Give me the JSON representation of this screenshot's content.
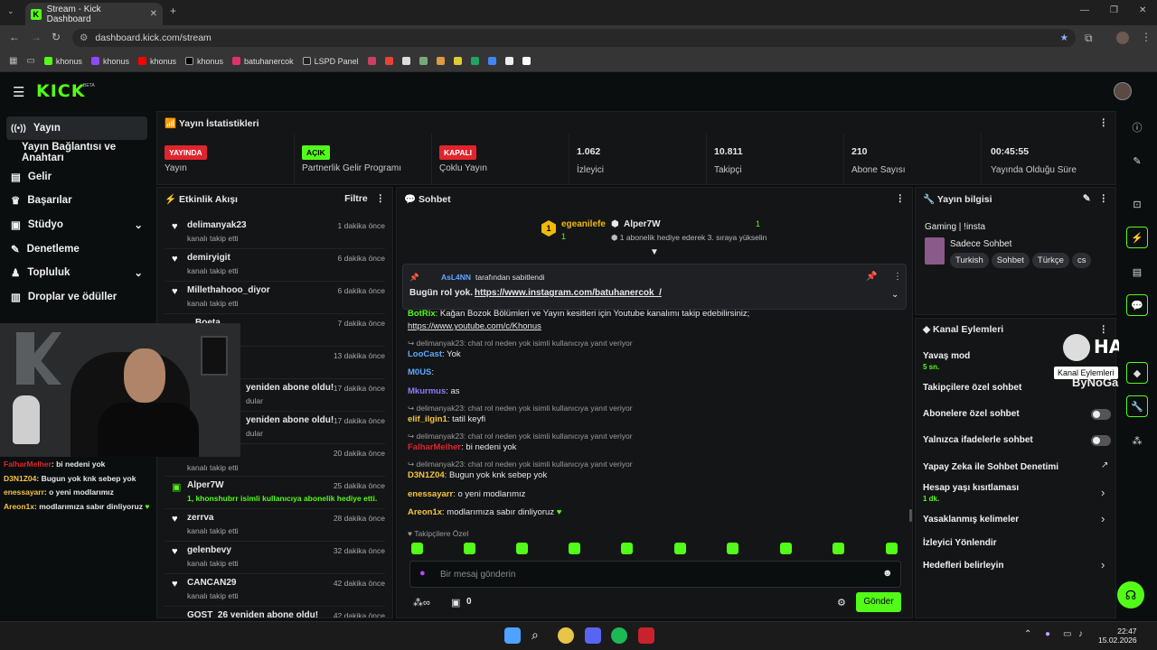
{
  "browser": {
    "tab_title": "Stream - Kick Dashboard",
    "url": "dashboard.kick.com/stream",
    "bookmarks": [
      "khonus",
      "khonus",
      "khonus",
      "khonus",
      "batuhanercok",
      "LSPD Panel"
    ]
  },
  "brand": {
    "logo": "KICK",
    "beta": "BETA",
    "accent": "#53fc18"
  },
  "sidebar": {
    "items": [
      {
        "label": "Yayın",
        "icon": "broadcast-icon"
      },
      {
        "label": "Yayın Bağlantısı ve Anahtarı",
        "icon": ""
      },
      {
        "label": "Gelir",
        "icon": "money-icon"
      },
      {
        "label": "Başarılar",
        "icon": "trophy-icon"
      },
      {
        "label": "Stüdyo",
        "icon": "studio-icon"
      },
      {
        "label": "Denetleme",
        "icon": "wrench-icon"
      },
      {
        "label": "Topluluk",
        "icon": "people-icon"
      },
      {
        "label": "Droplar ve ödüller",
        "icon": "gift-icon"
      }
    ]
  },
  "stats": {
    "title": "Yayın İstatistikleri",
    "items": [
      {
        "badge": "YAYINDA",
        "badge_color": "#e0242e",
        "label": "Yayın"
      },
      {
        "badge": "AÇIK",
        "badge_color": "#53fc18",
        "label": "Partnerlik Gelir Programı"
      },
      {
        "badge": "KAPALI",
        "badge_color": "#e0242e",
        "label": "Çoklu Yayın"
      },
      {
        "value": "1.062",
        "label": "İzleyici"
      },
      {
        "value": "10.811",
        "label": "Takipçi"
      },
      {
        "value": "210",
        "label": "Abone Sayısı"
      },
      {
        "value": "00:45:55",
        "label": "Yayında Olduğu Süre"
      }
    ]
  },
  "activity": {
    "title": "Etkinlik Akışı",
    "filter": "Filtre",
    "events": [
      {
        "name": "delimanyak23",
        "desc": "kanalı takip etti",
        "time": "1 dakika önce"
      },
      {
        "name": "demiryigit",
        "desc": "kanalı takip etti",
        "time": "6 dakika önce"
      },
      {
        "name": "Millethahooo_diyor",
        "desc": "kanalı takip etti",
        "time": "6 dakika önce"
      },
      {
        "name": "Boeta",
        "desc": "",
        "time": "7 dakika önce"
      },
      {
        "name": "",
        "desc": "",
        "time": "13 dakika önce"
      },
      {
        "name": "yeniden abone oldu!",
        "desc": "dular",
        "time": "17 dakika önce"
      },
      {
        "name": "yeniden abone oldu!",
        "desc": "dular",
        "time": "17 dakika önce"
      },
      {
        "name": "",
        "desc": "",
        "time": "20 dakika önce"
      },
      {
        "name": "",
        "desc": "kanalı takip etti",
        "time": ""
      },
      {
        "name": "Alper7W",
        "desc": "1, khonshubrr isimli kullanıcıya abonelik hediye etti.",
        "time": "25 dakika önce"
      },
      {
        "name": "zerrva",
        "desc": "kanalı takip etti",
        "time": "28 dakika önce"
      },
      {
        "name": "gelenbevy",
        "desc": "kanalı takip etti",
        "time": "32 dakika önce"
      },
      {
        "name": "CANCAN29",
        "desc": "kanalı takip etti",
        "time": "42 dakika önce"
      },
      {
        "name": "GOST_26 yeniden abone oldu!",
        "desc": "",
        "time": "42 dakika önce"
      }
    ]
  },
  "overlay_chat": [
    {
      "user": "FalharMelher",
      "text": ": bi nedeni yok",
      "color": "#e0242e"
    },
    {
      "user": "D3N1Z04",
      "text": ": Bugun yok knk sebep yok",
      "color": "#f5c542"
    },
    {
      "user": "enessayarr",
      "text": ": o yeni modlarımız",
      "color": "#f5c542"
    },
    {
      "user": "Areon1x",
      "text": ": modlarımıza sabır dinliyoruz",
      "color": "#f5c542"
    }
  ],
  "chat": {
    "title": "Sohbet",
    "top": [
      {
        "name": "egeanilefe",
        "count": "1"
      },
      {
        "name": "Alper7W",
        "count": "1",
        "note": "1 abonelik hediye ederek 3. sıraya yükselin"
      }
    ],
    "pinned": {
      "user": "AsL4NN",
      "by": "tarafından sabitlendi",
      "text": "Bugün rol yok.",
      "link": "https://www.instagram.com/batuhanercok_/"
    },
    "messages": [
      {
        "type": "msg",
        "user": "BotRix",
        "color": "#53fc18",
        "text": ": Kağan Bozok Bölümleri ve Yayın kesitleri için Youtube kanalımı takip edebilirsiniz;"
      },
      {
        "type": "link",
        "text": "https://www.youtube.com/c/Khonus"
      },
      {
        "type": "reply",
        "text": "delimanyak23: chat rol neden yok isimli kullanıcıya yanıt veriyor"
      },
      {
        "type": "msg",
        "user": "LooCast",
        "color": "#5fa8ff",
        "text": ": Yok"
      },
      {
        "type": "msg",
        "user": "M0US",
        "color": "#5fa8ff",
        "text": ":"
      },
      {
        "type": "msg",
        "user": "Mkurmus",
        "color": "#8a7dff",
        "text": ": as"
      },
      {
        "type": "reply",
        "text": "delimanyak23: chat rol neden yok isimli kullanıcıya yanıt veriyor"
      },
      {
        "type": "msg",
        "user": "elif_ilgin1",
        "color": "#f5c542",
        "text": ": tatil keyfi"
      },
      {
        "type": "reply",
        "text": "delimanyak23: chat rol neden yok isimli kullanıcıya yanıt veriyor"
      },
      {
        "type": "msg",
        "user": "FalharMelher",
        "color": "#e0242e",
        "text": ": bi nedeni yok"
      },
      {
        "type": "reply",
        "text": "delimanyak23: chat rol neden yok isimli kullanıcıya yanıt veriyor"
      },
      {
        "type": "msg",
        "user": "D3N1Z04",
        "color": "#f5c542",
        "text": ": Bugun yok knk sebep yok"
      },
      {
        "type": "msg",
        "user": "enessayarr",
        "color": "#f5c542",
        "text": ": o yeni modlarımız"
      },
      {
        "type": "msg",
        "user": "Areon1x",
        "color": "#f5c542",
        "text": ": modlarımıza sabır dinliyoruz"
      }
    ],
    "followers_only": "Takipçilere Özel",
    "placeholder": "Bir mesaj gönderin",
    "points": "0",
    "send": "Gönder"
  },
  "stream_info": {
    "title": "Yayın bilgisi",
    "stream_title": "Gaming | !insta",
    "category": "Sadece Sohbet",
    "tags": [
      "Turkish",
      "Sohbet",
      "Türkçe",
      "cs"
    ]
  },
  "channel_actions": {
    "title": "Kanal Eylemleri",
    "tooltip": "Kanal Eylemleri",
    "slow_mode": "Yavaş mod",
    "slow_value": "5 sn.",
    "items": [
      "Takipçilere özel sohbet",
      "Abonelere özel sohbet",
      "Yalnızca ifadelerle sohbet",
      "Yapay Zeka ile Sohbet Denetimi",
      "Hesap yaşı kısıtlaması",
      "Yasaklanmış kelimeler",
      "İzleyici Yönlendir",
      "Hedefleri belirleyin"
    ],
    "account_age": "1 dk."
  },
  "watermark": {
    "line1": "HAWK",
    "line2": "ByNoGame"
  },
  "taskbar": {
    "time": "22:47",
    "date": "15.02.2026"
  }
}
